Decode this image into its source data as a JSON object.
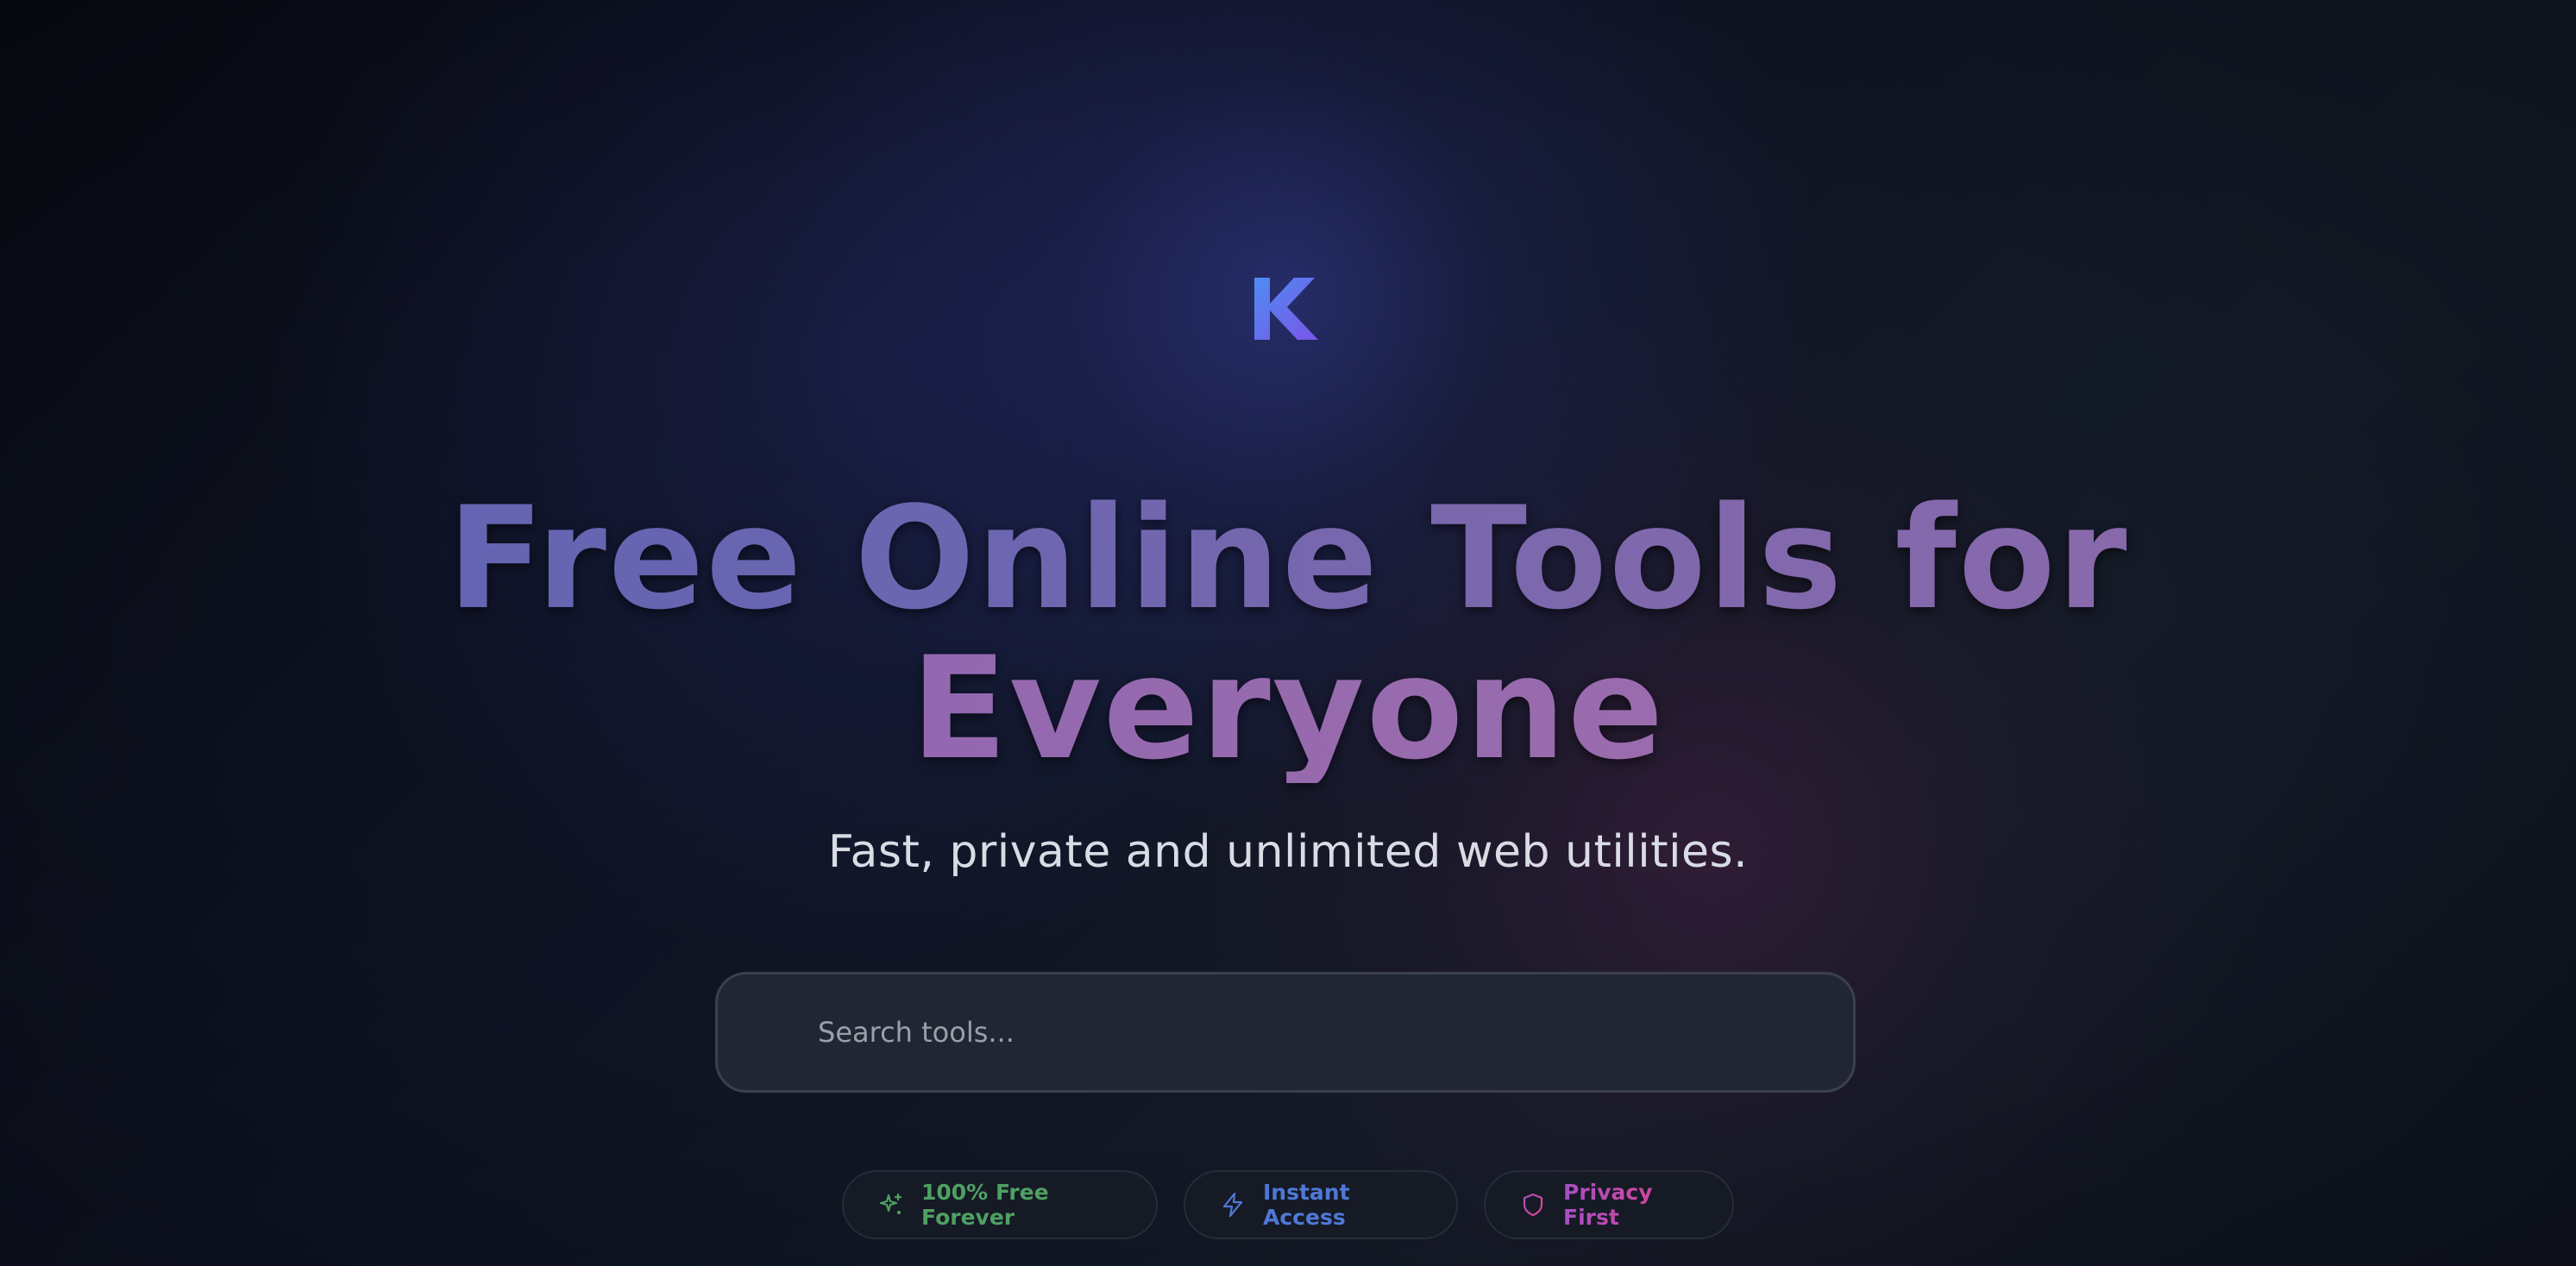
{
  "brand": {
    "logo_letter": "K",
    "logo_gradient": [
      "#4f8cf2",
      "#7a55e8"
    ]
  },
  "hero": {
    "headline_line1": "Free Online Tools for",
    "headline_line2": "Everyone",
    "subtitle": "Fast, private and unlimited web utilities."
  },
  "search": {
    "placeholder": "Search tools...",
    "value": ""
  },
  "badges": [
    {
      "label": "100% Free Forever",
      "icon": "sparkles-icon",
      "color": "#4fa063"
    },
    {
      "label": "Instant Access",
      "icon": "lightning-icon",
      "color": "#4f78d6"
    },
    {
      "label": "Privacy First",
      "icon": "shield-icon",
      "color": "#c44ea6"
    }
  ],
  "colors": {
    "background": "#0c101a",
    "accent_blue": "#5e63b4",
    "accent_purple": "#906aac",
    "search_bg": "#222633"
  }
}
